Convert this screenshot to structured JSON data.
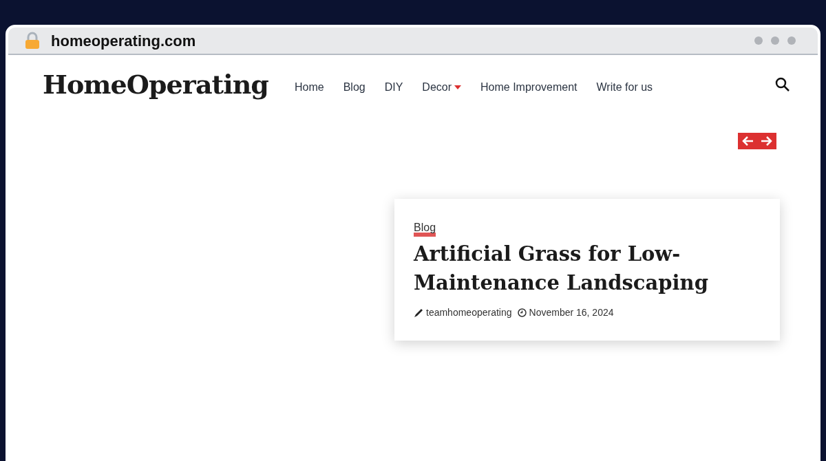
{
  "browser": {
    "url": "homeoperating.com"
  },
  "site": {
    "logo": "HomeOperating",
    "nav": [
      {
        "label": "Home",
        "dropdown": false
      },
      {
        "label": "Blog",
        "dropdown": false
      },
      {
        "label": "DIY",
        "dropdown": false
      },
      {
        "label": "Decor",
        "dropdown": true
      },
      {
        "label": "Home Improvement",
        "dropdown": false
      },
      {
        "label": "Write for us",
        "dropdown": false
      }
    ]
  },
  "slider": {
    "card": {
      "category": "Blog",
      "title": "Artificial Grass for Low-Maintenance Landscaping",
      "author": "teamhomeoperating",
      "date": "November 16, 2024"
    }
  }
}
